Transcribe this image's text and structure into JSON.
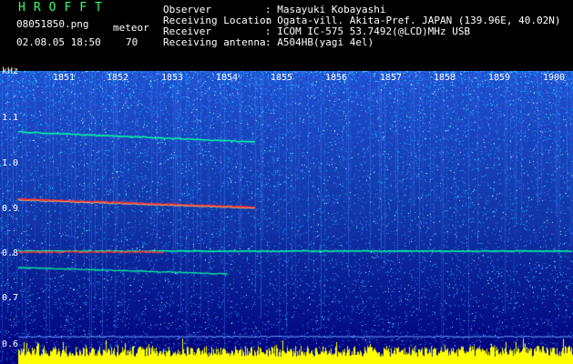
{
  "header": {
    "logo": "HROFFT",
    "filename": "08051850.png",
    "timestamp": "02.08.05 18:50",
    "counter_label": "meteor",
    "counter_value": "70"
  },
  "info": {
    "observer_label": "Observer",
    "observer_value": ": Masayuki Kobayashi",
    "location_label": "Receiving Location",
    "location_value": ": Ogata-vill. Akita-Pref. JAPAN (139.96E, 40.02N)",
    "receiver_label": "Receiver",
    "receiver_value": ": ICOM IC-575 53.7492(@LCD)MHz USB",
    "antenna_label": "Receiving antenna",
    "antenna_value": ": A504HB(yagi 4el)"
  },
  "spectrogram": {
    "y_unit": "kHz",
    "y_ticks": [
      "1.1",
      "1.0",
      "0.9",
      "0.8",
      "0.7",
      "0.6"
    ],
    "time_ticks": [
      "1851",
      "1852",
      "1853",
      "1854",
      "1855",
      "1856",
      "1857",
      "1858",
      "1859",
      "1900"
    ],
    "colors": {
      "background_dark": "#00007a",
      "background_light": "#2050d0",
      "noise": "#00c0ff",
      "signal": "#ff3030",
      "trace": "#00ffa0",
      "meter": "#ffff00"
    }
  }
}
